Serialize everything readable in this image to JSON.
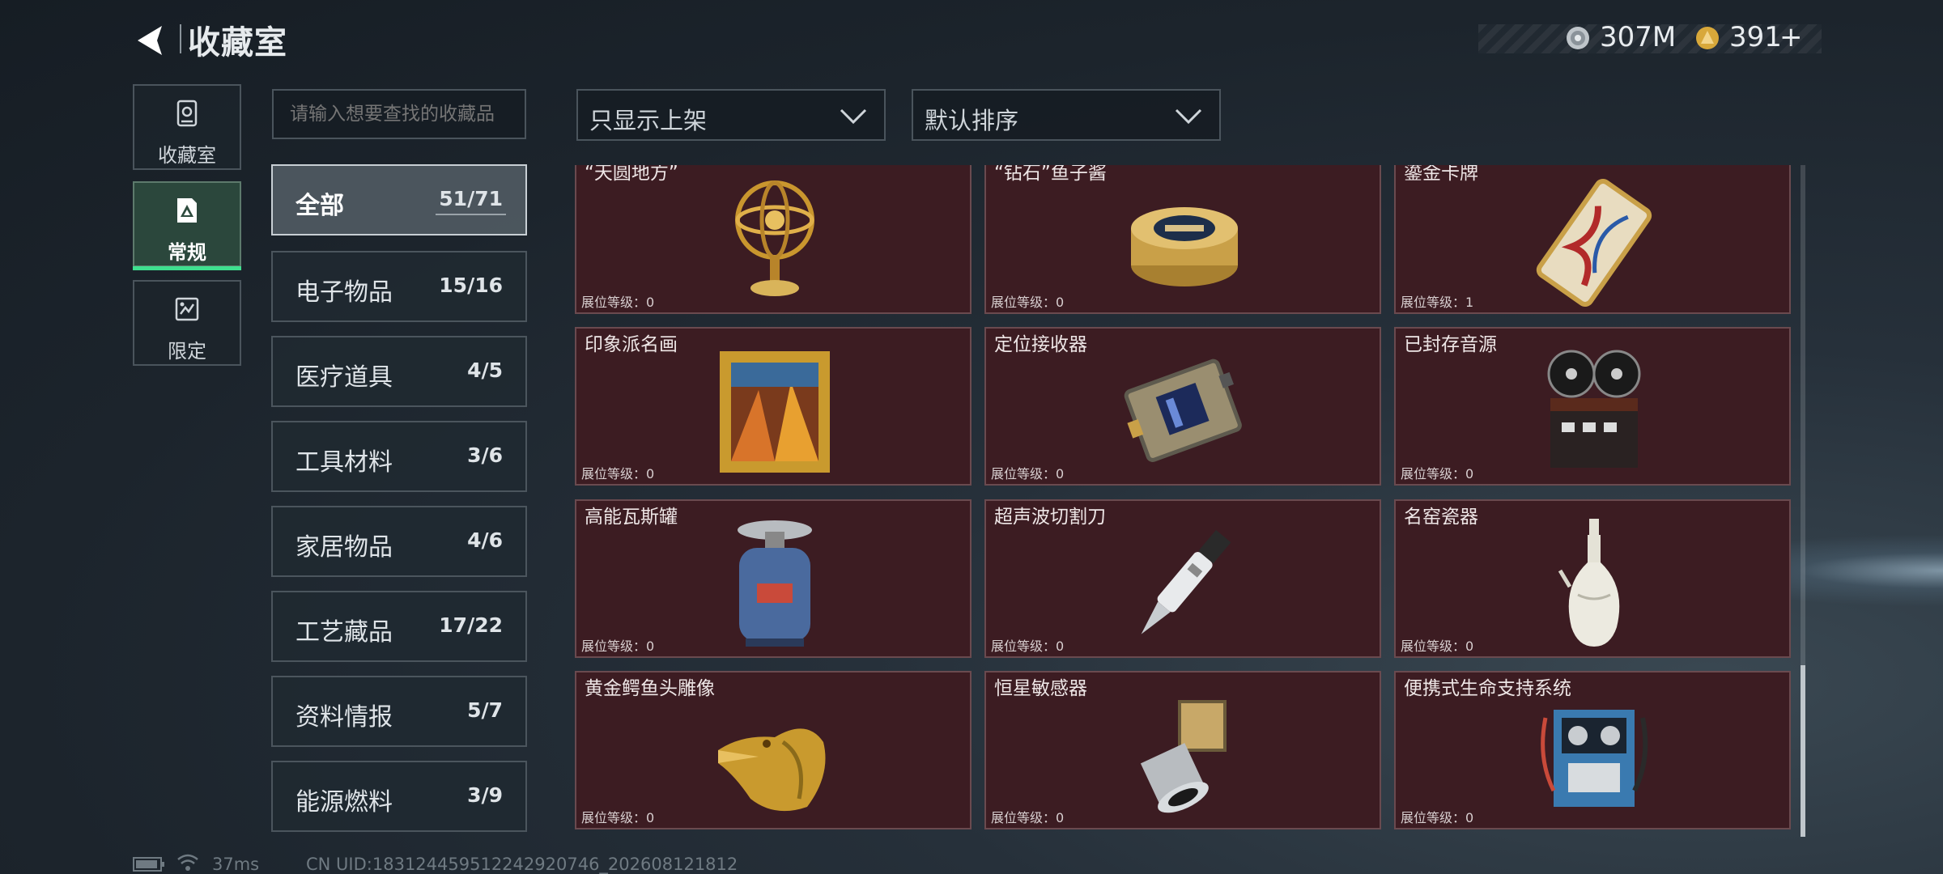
{
  "header": {
    "title": "收藏室",
    "currency_1": "307M",
    "currency_2": "391",
    "currency_2_add": "+"
  },
  "side_nav": [
    {
      "label": "收藏室",
      "icon": "collection-room-icon"
    },
    {
      "label": "常规",
      "icon": "regular-icon",
      "active": true
    },
    {
      "label": "限定",
      "icon": "limited-icon"
    }
  ],
  "search": {
    "placeholder": "请输入想要查找的收藏品"
  },
  "filters": {
    "display": "只显示上架",
    "sort": "默认排序"
  },
  "categories": [
    {
      "name": "全部",
      "count": "51/71",
      "active": true
    },
    {
      "name": "电子物品",
      "count": "15/16"
    },
    {
      "name": "医疗道具",
      "count": "4/5"
    },
    {
      "name": "工具材料",
      "count": "3/6"
    },
    {
      "name": "家居物品",
      "count": "4/6"
    },
    {
      "name": "工艺藏品",
      "count": "17/22"
    },
    {
      "name": "资料情报",
      "count": "5/7"
    },
    {
      "name": "能源燃料",
      "count": "3/9"
    }
  ],
  "items": [
    {
      "name": "“天圆地方”",
      "level": "展位等级：0",
      "icon": "armillary-sphere-icon"
    },
    {
      "name": "“钻石”鱼子酱",
      "level": "展位等级：0",
      "icon": "caviar-tin-icon"
    },
    {
      "name": "鎏金卡牌",
      "level": "展位等级：1",
      "icon": "gilded-card-icon"
    },
    {
      "name": "印象派名画",
      "level": "展位等级：0",
      "icon": "framed-painting-icon"
    },
    {
      "name": "定位接收器",
      "level": "展位等级：0",
      "icon": "locator-receiver-icon"
    },
    {
      "name": "已封存音源",
      "level": "展位等级：0",
      "icon": "reel-recorder-icon"
    },
    {
      "name": "高能瓦斯罐",
      "level": "展位等级：0",
      "icon": "gas-canister-icon"
    },
    {
      "name": "超声波切割刀",
      "level": "展位等级：0",
      "icon": "ultrasonic-cutter-icon"
    },
    {
      "name": "名窑瓷器",
      "level": "展位等级：0",
      "icon": "porcelain-vase-icon"
    },
    {
      "name": "黄金鳄鱼头雕像",
      "level": "展位等级：0",
      "icon": "gold-crocodile-statue-icon"
    },
    {
      "name": "恒星敏感器",
      "level": "展位等级：0",
      "icon": "star-sensor-icon"
    },
    {
      "name": "便携式生命支持系统",
      "level": "展位等级：0",
      "icon": "life-support-icon"
    }
  ],
  "status": {
    "ping": "37ms",
    "uid": "CN UID:183124459512242920746_202608121812"
  },
  "colors": {
    "accent": "#3ee08f",
    "card_bg": "#3c1c22",
    "card_border": "#6a4a4f"
  }
}
